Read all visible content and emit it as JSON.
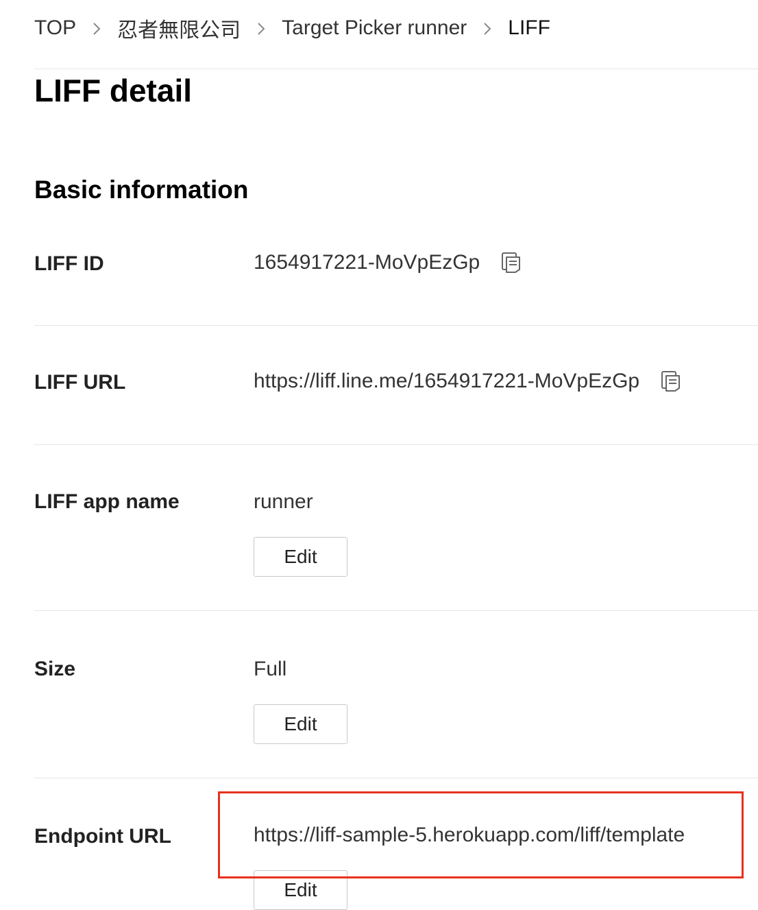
{
  "breadcrumb": {
    "items": [
      "TOP",
      "忍者無限公司",
      "Target Picker runner",
      "LIFF"
    ]
  },
  "page": {
    "title": "LIFF detail",
    "section_title": "Basic information"
  },
  "fields": {
    "liff_id": {
      "label": "LIFF ID",
      "value": "1654917221-MoVpEzGp",
      "icon": "copy-icon"
    },
    "liff_url": {
      "label": "LIFF URL",
      "value": "https://liff.line.me/1654917221-MoVpEzGp",
      "icon": "copy-icon"
    },
    "app_name": {
      "label": "LIFF app name",
      "value": "runner",
      "edit_label": "Edit"
    },
    "size": {
      "label": "Size",
      "value": "Full",
      "edit_label": "Edit"
    },
    "endpoint_url": {
      "label": "Endpoint URL",
      "value": "https://liff-sample-5.herokuapp.com/liff/template",
      "edit_label": "Edit"
    }
  },
  "colors": {
    "highlight": "#e8301c",
    "divider": "#e6e6e6"
  }
}
